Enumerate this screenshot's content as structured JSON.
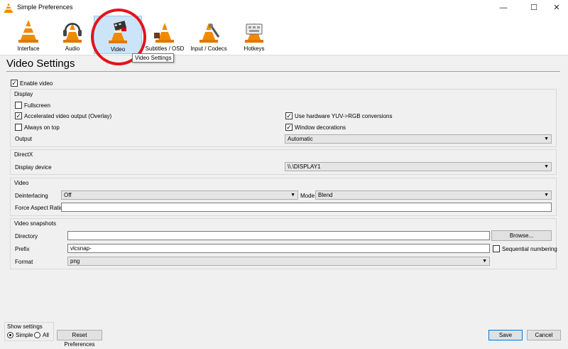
{
  "window": {
    "title": "Simple Preferences",
    "minimize": "—",
    "maximize": "☐",
    "close": "✕"
  },
  "toolbar": {
    "items": [
      {
        "label": "Interface"
      },
      {
        "label": "Audio"
      },
      {
        "label": "Video",
        "active": true
      },
      {
        "label": "Subtitles / OSD"
      },
      {
        "label": "Input / Codecs"
      },
      {
        "label": "Hotkeys"
      }
    ],
    "tooltip": "Video Settings"
  },
  "page_title": "Video Settings",
  "enable_video": {
    "label": "Enable video",
    "checked": true
  },
  "display": {
    "title": "Display",
    "fullscreen": {
      "label": "Fullscreen",
      "checked": false
    },
    "accelerated": {
      "label": "Accelerated video output (Overlay)",
      "checked": true
    },
    "always_on_top": {
      "label": "Always on top",
      "checked": false
    },
    "hw_yuv": {
      "label": "Use hardware YUV->RGB conversions",
      "checked": true
    },
    "window_decorations": {
      "label": "Window decorations",
      "checked": true
    },
    "output_label": "Output",
    "output_value": "Automatic"
  },
  "directx": {
    "title": "DirectX",
    "display_device_label": "Display device",
    "display_device_value": "\\\\.\\DISPLAY1"
  },
  "video": {
    "title": "Video",
    "deinterlacing_label": "Deinterlacing",
    "deinterlacing_value": "Off",
    "mode_label": "Mode",
    "mode_value": "Blend",
    "aspect_label": "Force Aspect Ratio",
    "aspect_value": ""
  },
  "snapshots": {
    "title": "Video snapshots",
    "directory_label": "Directory",
    "directory_value": "",
    "browse_label": "Browse...",
    "prefix_label": "Prefix",
    "prefix_value": "vlcsnap-",
    "sequential": {
      "label": "Sequential numbering",
      "checked": false
    },
    "format_label": "Format",
    "format_value": "png"
  },
  "footer": {
    "show_settings_title": "Show settings",
    "simple_label": "Simple",
    "all_label": "All",
    "selected": "Simple",
    "reset_label": "Reset Preferences",
    "save_label": "Save",
    "cancel_label": "Cancel"
  },
  "colors": {
    "accent_circle": "#e5131b",
    "active_tab": "#cce4f7",
    "cone_orange": "#f08a00"
  },
  "icons": [
    "vlc-cone-icon",
    "headphones-icon",
    "film-clapper-icon",
    "subtitles-icon",
    "codecs-icon",
    "hotkeys-icon"
  ]
}
